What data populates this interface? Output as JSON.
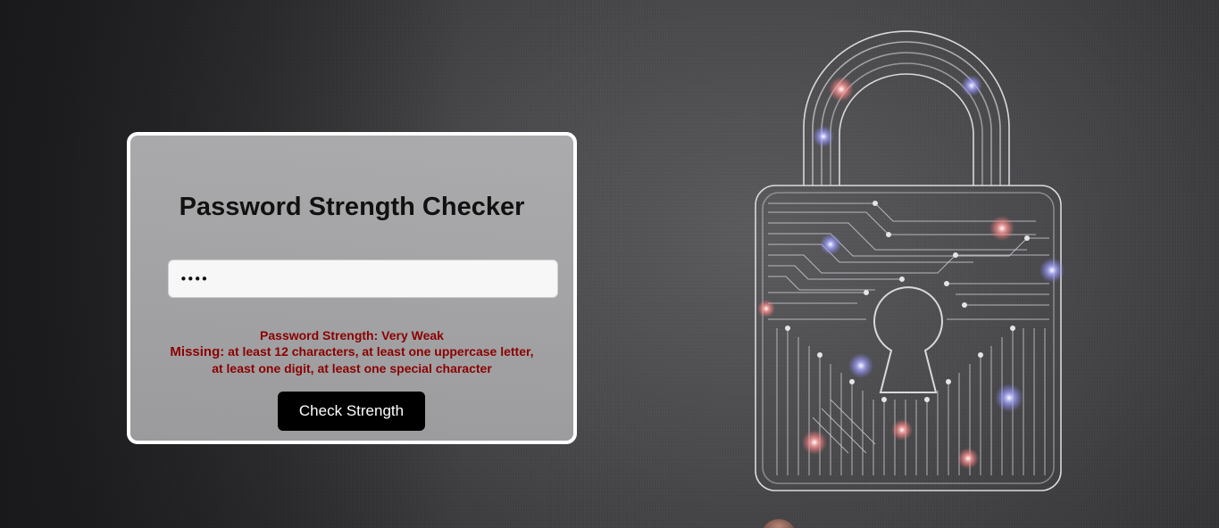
{
  "card": {
    "title": "Password Strength Checker",
    "password_value": "••••",
    "strength_line": "Password Strength: Very Weak",
    "missing_label": "Missing:",
    "missing_text": " at least 12 characters, at least one uppercase letter, at least one digit, at least one special character",
    "button_label": "Check Strength"
  },
  "colors": {
    "result_text": "#8b0000",
    "button_bg": "#000000",
    "card_border": "#ffffff"
  },
  "icons": {
    "background_art": "circuit-padlock-icon"
  }
}
